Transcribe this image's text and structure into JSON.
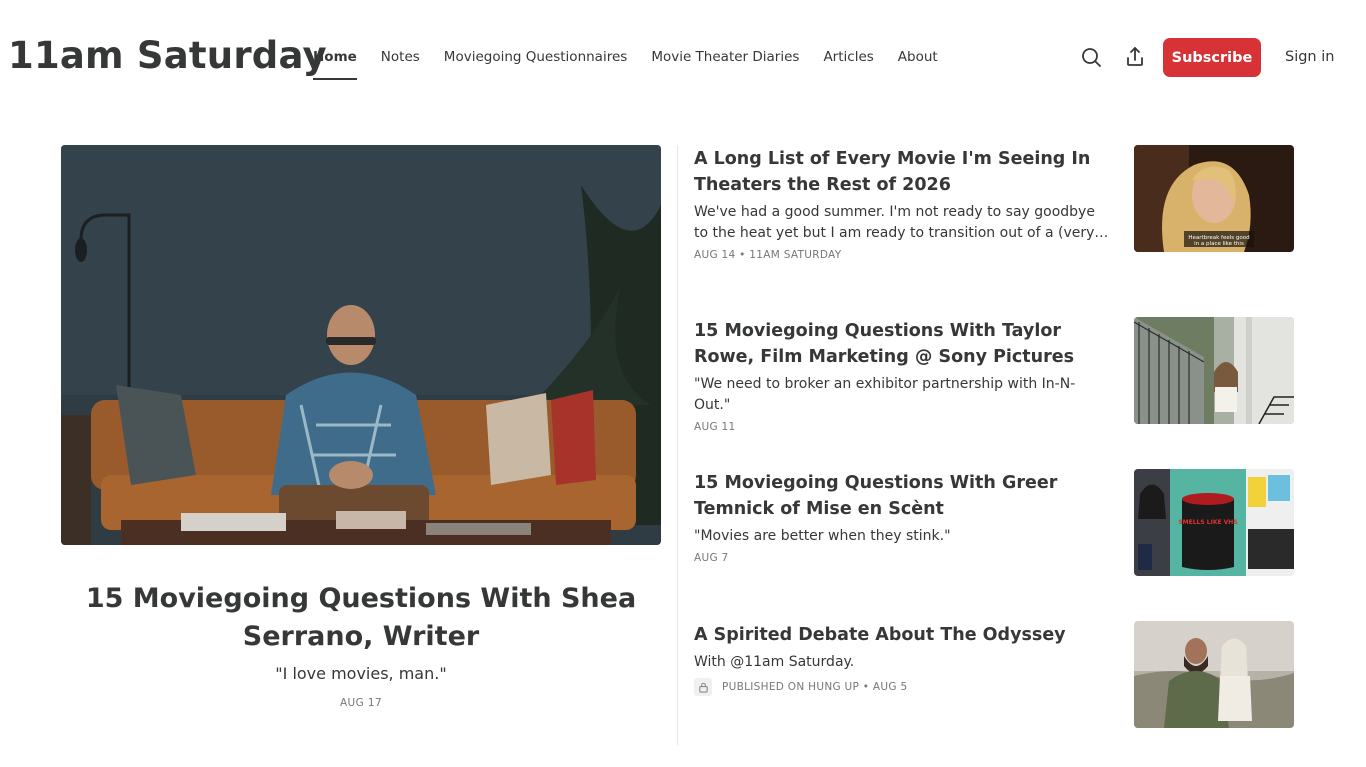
{
  "site": {
    "title": "11am Saturday"
  },
  "nav": {
    "items": [
      {
        "label": "Home"
      },
      {
        "label": "Notes"
      },
      {
        "label": "Moviegoing Questionnaires"
      },
      {
        "label": "Movie Theater Diaries"
      },
      {
        "label": "Articles"
      },
      {
        "label": "About"
      }
    ]
  },
  "header": {
    "subscribe_label": "Subscribe",
    "signin_label": "Sign in",
    "accent_color": "#d73336"
  },
  "hero": {
    "title": "15 Moviegoing Questions With Shea Serrano, Writer",
    "subtitle": "\"I love movies, man.\"",
    "date": "AUG 17"
  },
  "posts": [
    {
      "title": "A Long List of Every Movie I'm Seeing In Theaters the Rest of 2026",
      "subtitle": "We've had a good summer. I'm not ready to say goodbye to the heat yet but I am ready to transition out of a (very…",
      "meta": "AUG 14 • 11AM SATURDAY",
      "thumb_caption_line1": "Heartbreak feels good",
      "thumb_caption_line2": "in a place like this"
    },
    {
      "title": "15 Moviegoing Questions With Taylor Rowe, Film Marketing @ Sony Pictures",
      "subtitle": "\"We need to broker an exhibitor partnership with In-N-Out.\"",
      "meta": "AUG 11"
    },
    {
      "title": "15 Moviegoing Questions With Greer Temnick of Mise en Scènt",
      "subtitle": "\"Movies are better when they stink.\"",
      "meta": "AUG 7",
      "thumb_candle_label": "SMELLS LIKE VHS"
    },
    {
      "title": "A Spirited Debate About The Odyssey",
      "subtitle": "With @11am Saturday.",
      "meta": "PUBLISHED ON HUNG UP • AUG 5",
      "locked": true
    }
  ]
}
